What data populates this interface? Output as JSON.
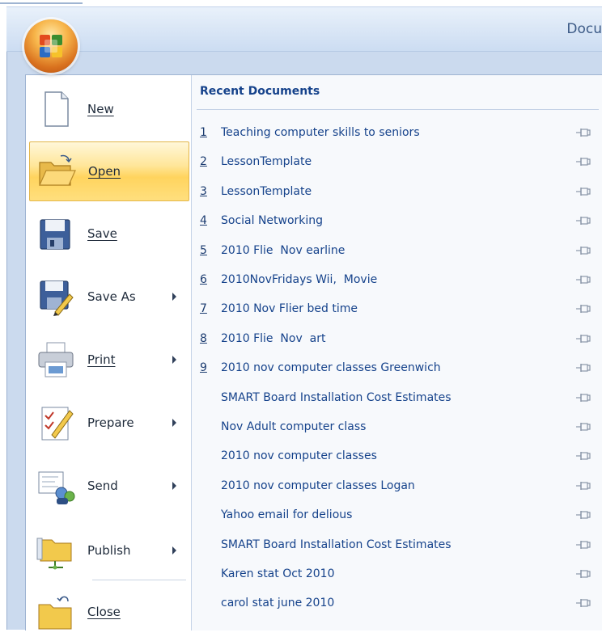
{
  "window": {
    "title": "Docu"
  },
  "office_button": {
    "icon": "office-logo-icon"
  },
  "menu": {
    "items": [
      {
        "label": "New",
        "icon": "new-document-icon",
        "has_submenu": false
      },
      {
        "label": "Open",
        "icon": "open-folder-icon",
        "has_submenu": false,
        "active": true
      },
      {
        "label": "Save",
        "icon": "floppy-disk-icon",
        "has_submenu": false
      },
      {
        "label": "Save As",
        "icon": "save-as-icon",
        "has_submenu": true
      },
      {
        "label": "Print",
        "icon": "printer-icon",
        "has_submenu": true
      },
      {
        "label": "Prepare",
        "icon": "prepare-icon",
        "has_submenu": true
      },
      {
        "label": "Send",
        "icon": "send-icon",
        "has_submenu": true
      },
      {
        "label": "Publish",
        "icon": "publish-icon",
        "has_submenu": true
      },
      {
        "label": "Close",
        "icon": "close-folder-icon",
        "has_submenu": false
      }
    ]
  },
  "recent": {
    "header": "Recent Documents",
    "documents": [
      {
        "num": "1",
        "name": "Teaching computer skills to seniors"
      },
      {
        "num": "2",
        "name": "LessonTemplate"
      },
      {
        "num": "3",
        "name": "LessonTemplate"
      },
      {
        "num": "4",
        "name": "Social Networking"
      },
      {
        "num": "5",
        "name": "2010 Flie  Nov earline"
      },
      {
        "num": "6",
        "name": "2010NovFridays Wii,  Movie"
      },
      {
        "num": "7",
        "name": "2010 Nov Flier bed time"
      },
      {
        "num": "8",
        "name": "2010 Flie  Nov  art"
      },
      {
        "num": "9",
        "name": "2010 nov computer classes Greenwich"
      },
      {
        "num": "",
        "name": "SMART Board Installation Cost Estimates"
      },
      {
        "num": "",
        "name": "Nov Adult computer class"
      },
      {
        "num": "",
        "name": "2010 nov computer classes"
      },
      {
        "num": "",
        "name": "2010 nov computer classes Logan"
      },
      {
        "num": "",
        "name": "Yahoo email for delious"
      },
      {
        "num": "",
        "name": "SMART Board Installation Cost Estimates"
      },
      {
        "num": "",
        "name": "Karen stat Oct 2010"
      },
      {
        "num": "",
        "name": "carol stat june 2010"
      }
    ],
    "pin_icon": "pin-icon"
  }
}
